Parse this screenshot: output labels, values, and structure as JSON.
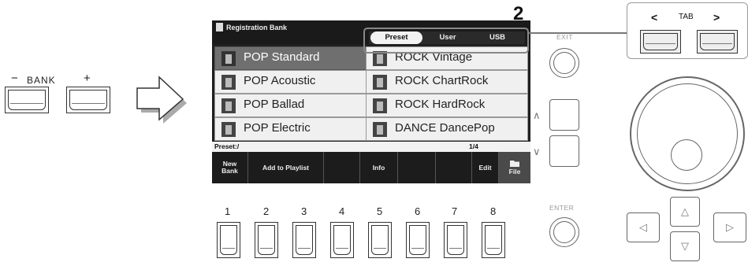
{
  "bank": {
    "label": "BANK",
    "minus": "−",
    "plus": "+"
  },
  "screen": {
    "title": "Registration Bank",
    "tabs": [
      {
        "label": "Preset",
        "selected": true
      },
      {
        "label": "User",
        "selected": false
      },
      {
        "label": "USB",
        "selected": false
      }
    ],
    "banks_left": [
      "POP Standard",
      "POP Acoustic",
      "POP Ballad",
      "POP Electric"
    ],
    "banks_right": [
      "ROCK Vintage",
      "ROCK ChartRock",
      "ROCK HardRock",
      "DANCE DancePop"
    ],
    "path": "Preset:/",
    "page": "1/4",
    "function_keys": {
      "new_bank": "New Bank",
      "add_to_playlist": "Add to Playlist",
      "info": "Info",
      "edit": "Edit",
      "file": "File"
    }
  },
  "callout": "2",
  "button_numbers": [
    "1",
    "2",
    "3",
    "4",
    "5",
    "6",
    "7",
    "8"
  ],
  "panel": {
    "exit_label": "EXIT",
    "enter_label": "ENTER",
    "up": "∧",
    "down": "∨",
    "tab_label": "TAB",
    "tab_prev": "<",
    "tab_next": ">",
    "cursor_up": "△",
    "cursor_down": "▽",
    "cursor_left": "◁",
    "cursor_right": "▷"
  }
}
